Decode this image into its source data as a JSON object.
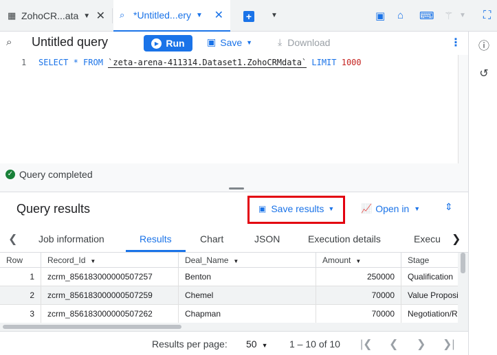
{
  "tabs": [
    {
      "label": "ZohoCR...ata",
      "icon": "table-icon"
    },
    {
      "label": "*Untitled...ery",
      "icon": "query-icon"
    }
  ],
  "toolbar": {
    "title": "Untitled query",
    "run_label": "Run",
    "save_label": "Save",
    "download_label": "Download"
  },
  "editor": {
    "line_number": "1",
    "sql_prefix": "SELECT * FROM ",
    "sql_table": "`zeta-arena-411314.Dataset1.ZohoCRMdata`",
    "sql_limit_kw": " LIMIT ",
    "sql_limit_val": "1000"
  },
  "status": {
    "text": "Query completed"
  },
  "results": {
    "title": "Query results",
    "save_results_label": "Save results",
    "open_in_label": "Open in",
    "tabs": [
      "Job information",
      "Results",
      "Chart",
      "JSON",
      "Execution details",
      "Execu"
    ],
    "active_tab": "Results",
    "columns": [
      "Row",
      "Record_Id",
      "Deal_Name",
      "Amount",
      "Stage"
    ],
    "rows": [
      {
        "row": "1",
        "record_id": "zcrm_856183000000507257",
        "deal_name": "Benton",
        "amount": "250000",
        "stage": "Qualification"
      },
      {
        "row": "2",
        "record_id": "zcrm_856183000000507259",
        "deal_name": "Chemel",
        "amount": "70000",
        "stage": "Value Proposi"
      },
      {
        "row": "3",
        "record_id": "zcrm_856183000000507262",
        "deal_name": "Chapman",
        "amount": "70000",
        "stage": "Negotiation/R"
      }
    ]
  },
  "pagination": {
    "label": "Results per page:",
    "page_size": "50",
    "range": "1 – 10 of 10"
  },
  "colors": {
    "accent": "#1a73e8",
    "highlight": "#e3000f",
    "success": "#188038"
  }
}
